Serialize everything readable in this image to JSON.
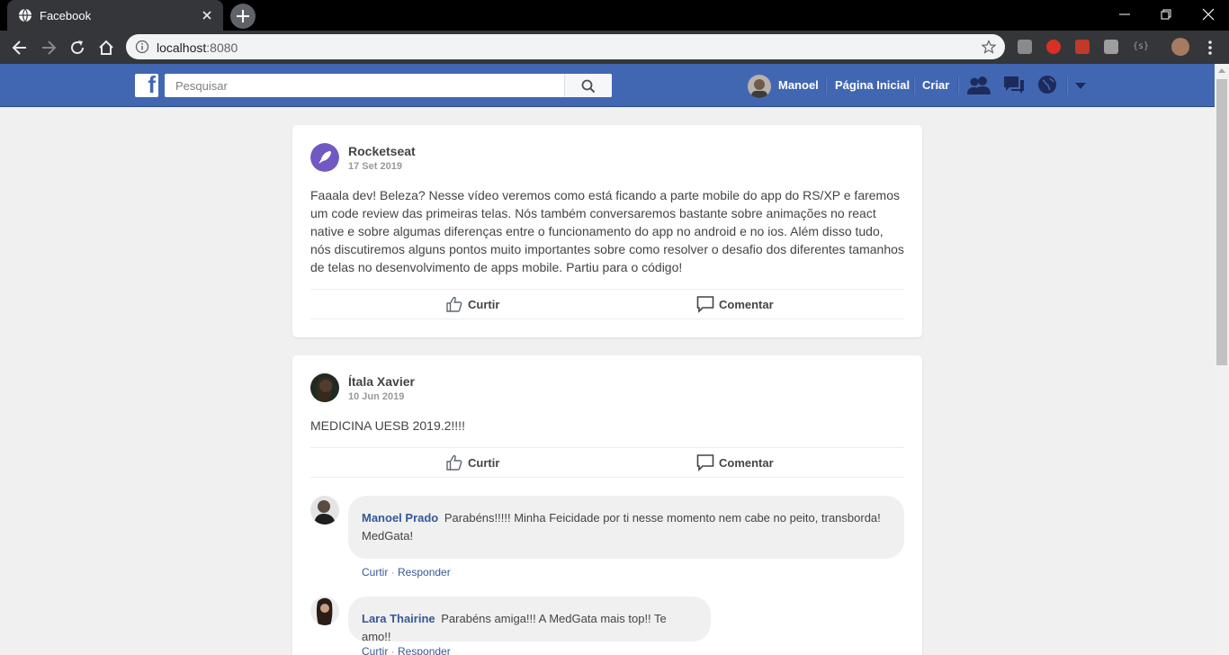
{
  "browser": {
    "tab_title": "Facebook",
    "url_host": "localhost",
    "url_port": ":8080"
  },
  "header": {
    "search_placeholder": "Pesquisar",
    "user_name": "Manoel",
    "home_link": "Página Inicial",
    "create_link": "Criar"
  },
  "posts": [
    {
      "author": "Rocketseat",
      "date": "17 Set 2019",
      "content": "Faaala dev! Beleza? Nesse vídeo veremos como está ficando a parte mobile do app do RS/XP e faremos um code review das primeiras telas. Nós também conversaremos bastante sobre animações no react native e sobre algumas diferenças entre o funcionamento do app no android e no ios. Além disso tudo, nós discutiremos alguns pontos muito importantes sobre como resolver o desafio dos diferentes tamanhos de telas no desenvolvimento de apps mobile. Partiu para o código!",
      "like_label": "Curtir",
      "comment_label": "Comentar"
    },
    {
      "author": "Ítala Xavier",
      "date": "10 Jun 2019",
      "content": "MEDICINA UESB 2019.2!!!!",
      "like_label": "Curtir",
      "comment_label": "Comentar",
      "comments": [
        {
          "author": "Manoel Prado",
          "text": "Parabéns!!!!! Minha Feicidade por ti nesse momento nem cabe no peito, transborda! MedGata!",
          "like": "Curtir",
          "reply": "Responder"
        },
        {
          "author": "Lara Thairine",
          "text": "Parabéns amiga!!! A MedGata mais top!! Te amo!!",
          "like": "Curtir",
          "reply": "Responder"
        }
      ]
    }
  ],
  "colors": {
    "fb_blue": "#4267b2",
    "link_blue": "#365899",
    "page_bg": "#f0f0f0",
    "rocketseat_purple": "#7159c1"
  }
}
